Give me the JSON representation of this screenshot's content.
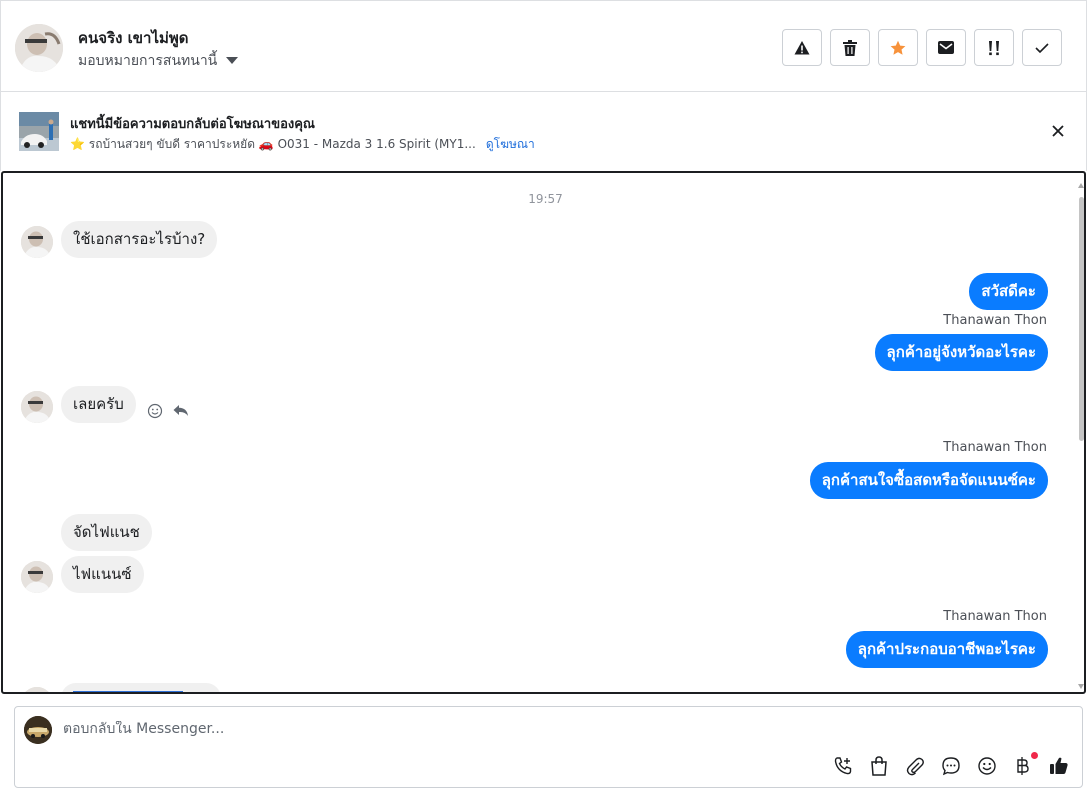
{
  "header": {
    "contact_name": "คนจริง เขาไม่พูด",
    "assign_label": "มอบหมายการสนทนานี้",
    "actions": [
      {
        "name": "spam-button",
        "icon": "warning-icon"
      },
      {
        "name": "delete-button",
        "icon": "trash-icon"
      },
      {
        "name": "star-button",
        "icon": "star-icon"
      },
      {
        "name": "unread-button",
        "icon": "envelope-icon"
      },
      {
        "name": "follow-up-button",
        "icon": "exclamation-icon"
      },
      {
        "name": "done-button",
        "icon": "check-icon"
      }
    ],
    "star_color": "#f7923b"
  },
  "ad_banner": {
    "title": "แชทนี้มีข้อความตอบกลับต่อโฆษณาของคุณ",
    "subtitle": "⭐ รถบ้านสวยๆ ขับดี ราคาประหยัด 🚗 O031 - Mazda 3 1.6 Spirit (MY1...",
    "link_label": "ดูโฆษณา"
  },
  "chat": {
    "timestamp": "19:57",
    "accent_color": "#0a7cff",
    "messages": [
      {
        "direction": "in",
        "text": "ใช้เอกสารอะไรบ้าง?"
      },
      {
        "direction": "out",
        "text": "สวัสดีคะ"
      },
      {
        "direction": "out",
        "sender": "Thanawan Thon",
        "text": "ลุกค้าอยู่จังหวัดอะไรคะ"
      },
      {
        "direction": "in",
        "text": "เลยครับ"
      },
      {
        "direction": "out",
        "sender": "Thanawan Thon",
        "text": "ลุกค้าสนใจซื้อสดหรือจัดแนนซ์คะ"
      },
      {
        "direction": "in",
        "text": "จัดไฟแนช"
      },
      {
        "direction": "in",
        "text": "ไฟแนนซ์"
      },
      {
        "direction": "out",
        "sender": "Thanawan Thon",
        "text": "ลุกค้าประกอบอาชีพอะไรคะ"
      }
    ]
  },
  "composer": {
    "placeholder": "ตอบกลับใน Messenger...",
    "tools": [
      "call-icon",
      "shopping-bag-icon",
      "paperclip-icon",
      "chat-bubble-icon",
      "emoji-icon",
      "baht-icon",
      "thumbs-up-icon"
    ]
  }
}
